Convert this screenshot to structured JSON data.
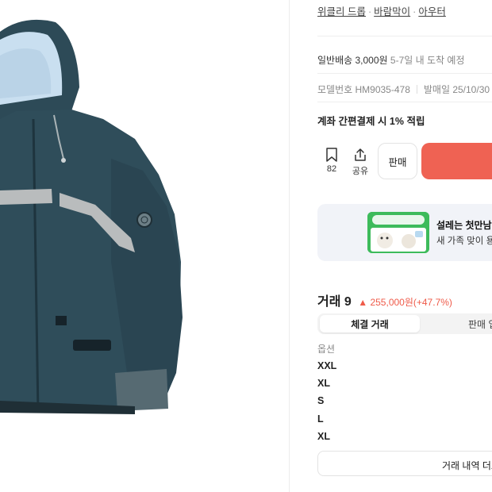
{
  "product_image": {
    "alt_icon": "jacket-image",
    "colors": {
      "body": "#2f4d5a",
      "stripe": "#b9bcbd",
      "hood_lining": "#c9dff0"
    }
  },
  "breadcrumb": [
    "위클리 드롭",
    "바람막이",
    "아우터"
  ],
  "breadcrumb_sep": "·",
  "shipping": {
    "label": "일반배송 3,000원",
    "eta": "5-7일 내 도착 예정"
  },
  "meta": {
    "model": "모델번호 HM9035-478",
    "release": "발매일 25/10/30"
  },
  "points": "계좌 간편결제 시 1% 적립",
  "actions": {
    "bookmark_count": "82",
    "share_label": "공유",
    "sell_label": "판매",
    "buy_color": "#ef6253"
  },
  "banner": {
    "title": "설레는 첫만남, 저",
    "subtitle": "새 가족 맞이 용품"
  },
  "trade": {
    "title": "거래 9",
    "change": "▲ 255,000원(+47.7%)",
    "change_color": "#ef5b4a"
  },
  "tabs": [
    {
      "label": "체결 거래",
      "active": true
    },
    {
      "label": "판매 입찰",
      "active": false
    }
  ],
  "options": {
    "header": "옵션",
    "rows": [
      "XXL",
      "XL",
      "S",
      "L",
      "XL"
    ]
  },
  "history_button": "거래 내역 더보기"
}
